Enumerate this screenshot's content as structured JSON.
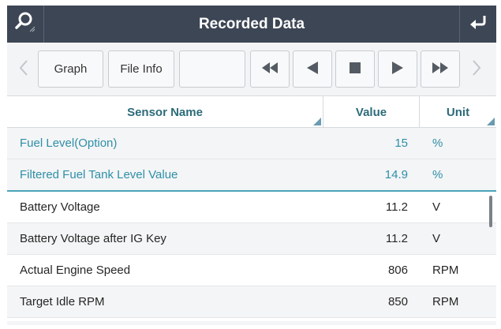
{
  "header": {
    "title": "Recorded Data",
    "left_icon": "search-icon",
    "right_icon": "back-return-icon",
    "bg_color": "#3d4655"
  },
  "toolbar": {
    "prev_icon": "chevron-left-icon",
    "next_icon": "chevron-right-icon",
    "graph_label": "Graph",
    "file_info_label": "File Info",
    "blank_label": "",
    "rewind_icon": "fast-rewind-icon",
    "step_back_icon": "step-back-icon",
    "stop_icon": "stop-icon",
    "play_icon": "play-icon",
    "fast_forward_icon": "fast-forward-icon"
  },
  "table": {
    "headers": {
      "sensor_name": "Sensor Name",
      "value": "Value",
      "unit": "Unit"
    },
    "rows": [
      {
        "name": "Fuel Level(Option)",
        "value": "15",
        "unit": "%"
      },
      {
        "name": "Filtered Fuel Tank Level Value",
        "value": "14.9",
        "unit": "%"
      },
      {
        "name": "Battery Voltage",
        "value": "11.2",
        "unit": "V"
      },
      {
        "name": "Battery Voltage after IG Key",
        "value": "11.2",
        "unit": "V"
      },
      {
        "name": "Actual Engine Speed",
        "value": "806",
        "unit": "RPM"
      },
      {
        "name": "Target Idle RPM",
        "value": "850",
        "unit": "RPM"
      }
    ]
  },
  "colors": {
    "accent": "#2e8fa8",
    "header_text": "#2d6b7a"
  }
}
